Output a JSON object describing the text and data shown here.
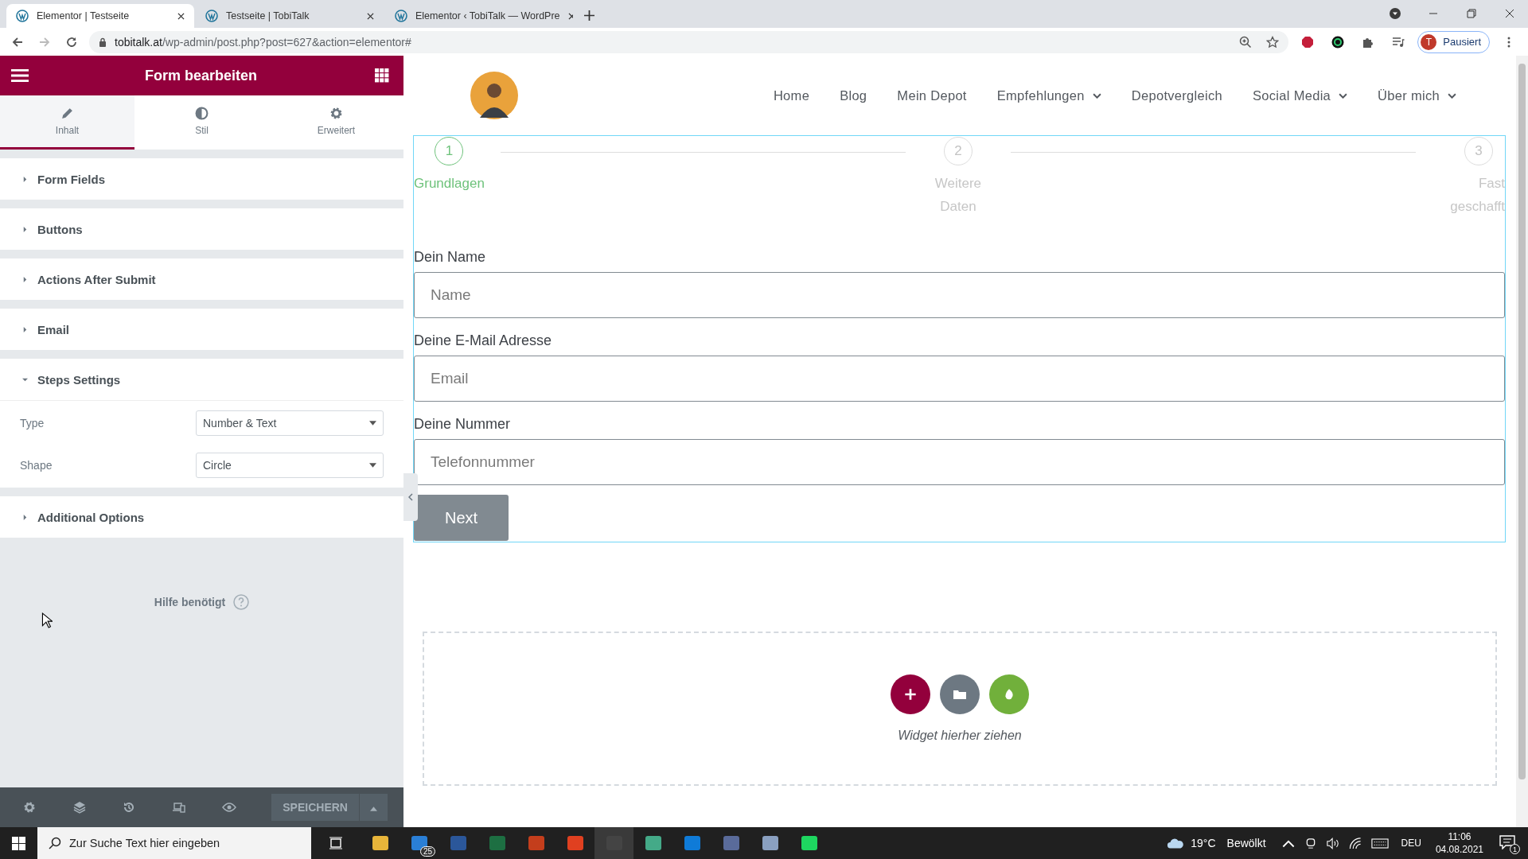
{
  "browser": {
    "tabs": [
      {
        "title": "Elementor | Testseite",
        "selected": true
      },
      {
        "title": "Testseite | TobiTalk",
        "selected": false
      },
      {
        "title": "Elementor ‹ TobiTalk — WordPre",
        "selected": false
      }
    ],
    "url": {
      "host": "tobitalk.at",
      "path": "/wp-admin/post.php?post=627&action=elementor#"
    },
    "profile": {
      "initial": "T",
      "label": "Pausiert"
    }
  },
  "editor": {
    "title": "Form bearbeiten",
    "tabs": [
      {
        "label": "Inhalt",
        "kind": "pencil",
        "selected": true
      },
      {
        "label": "Stil",
        "kind": "contrast",
        "selected": false
      },
      {
        "label": "Erweitert",
        "kind": "gear",
        "selected": false
      }
    ],
    "sections": [
      {
        "title": "Form Fields",
        "expanded": false
      },
      {
        "title": "Buttons",
        "expanded": false
      },
      {
        "title": "Actions After Submit",
        "expanded": false
      },
      {
        "title": "Email",
        "expanded": false
      },
      {
        "title": "Steps Settings",
        "expanded": true,
        "settings": [
          {
            "label": "Type",
            "value": "Number & Text"
          },
          {
            "label": "Shape",
            "value": "Circle"
          }
        ]
      },
      {
        "title": "Additional Options",
        "expanded": false
      }
    ],
    "help": "Hilfe benötigt",
    "save": "SPEICHERN"
  },
  "site": {
    "nav": [
      {
        "label": "Home",
        "dropdown": false
      },
      {
        "label": "Blog",
        "dropdown": false
      },
      {
        "label": "Mein Depot",
        "dropdown": false
      },
      {
        "label": "Empfehlungen",
        "dropdown": true
      },
      {
        "label": "Depotvergleich",
        "dropdown": false
      },
      {
        "label": "Social Media",
        "dropdown": true
      },
      {
        "label": "Über mich",
        "dropdown": true
      }
    ],
    "steps": [
      {
        "number": "1",
        "label": "Grundlagen",
        "selected": true
      },
      {
        "number": "2",
        "label": "Weitere Daten",
        "selected": false
      },
      {
        "number": "3",
        "label": "Fast geschafft",
        "selected": false
      }
    ],
    "fields": [
      {
        "label": "Dein Name",
        "placeholder": "Name"
      },
      {
        "label": "Deine E-Mail Adresse",
        "placeholder": "Email"
      },
      {
        "label": "Deine Nummer",
        "placeholder": "Telefonnummer"
      }
    ],
    "button": "Next",
    "dropzone": "Widget hierher ziehen"
  },
  "taskbar": {
    "search": "Zur Suche Text hier eingeben",
    "mail_badge": "25",
    "temperature": "19°C",
    "weather": "Bewölkt",
    "language": "DEU",
    "time": "11:06",
    "date": "04.08.2021",
    "notifications": "1"
  }
}
